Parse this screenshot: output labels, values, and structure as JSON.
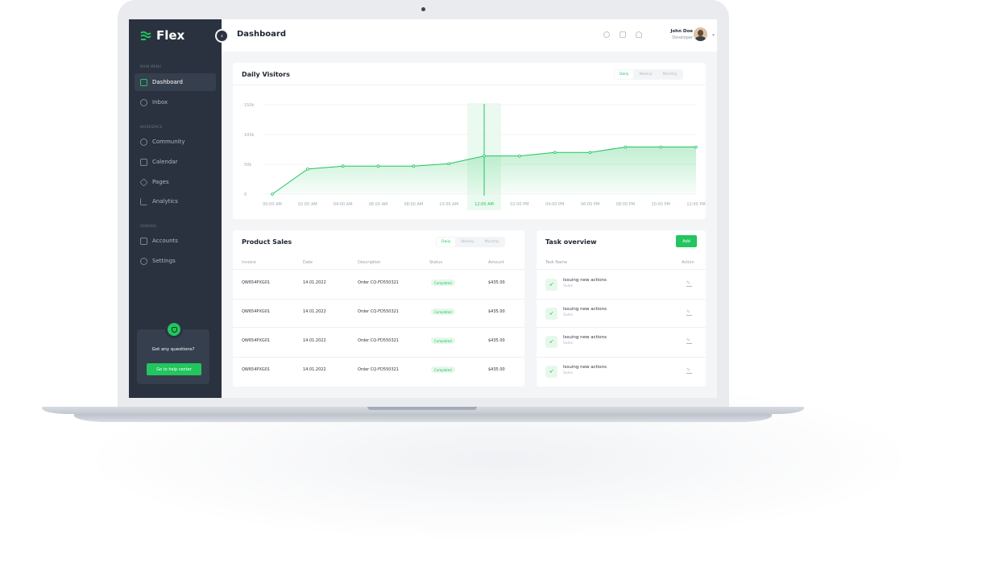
{
  "app": {
    "name": "Flex"
  },
  "sidebar": {
    "sections": [
      {
        "label": "MAIN MENU",
        "items": [
          {
            "label": "Dashboard",
            "icon": "chart-icon",
            "active": true
          },
          {
            "label": "Inbox",
            "icon": "inbox-icon"
          }
        ]
      },
      {
        "label": "Workspace",
        "items": [
          {
            "label": "Community",
            "icon": "people-icon"
          },
          {
            "label": "Calendar",
            "icon": "calendar-icon"
          },
          {
            "label": "Pages",
            "icon": "layers-icon"
          },
          {
            "label": "Analytics",
            "icon": "bars-icon"
          }
        ]
      },
      {
        "label": "General",
        "items": [
          {
            "label": "Accounts",
            "icon": "user-icon"
          },
          {
            "label": "Settings",
            "icon": "gear-icon"
          }
        ]
      }
    ],
    "help": {
      "text": "Got any questions?",
      "button": "Go to help center"
    }
  },
  "header": {
    "title": "Dashboard",
    "user_name": "John Doe",
    "user_role": "Developer"
  },
  "visitors": {
    "title": "Daily Visitors",
    "tabs": [
      "Daily",
      "Weekly",
      "Monthly"
    ],
    "active_tab": "Daily"
  },
  "chart_data": {
    "type": "area",
    "title": "Daily Visitors",
    "x": [
      "00:00 AM",
      "02:00 AM",
      "04:00 AM",
      "06:00 AM",
      "08:00 AM",
      "10:00 AM",
      "12:00 AM",
      "02:00 PM",
      "04:00 PM",
      "06:00 PM",
      "08:00 PM",
      "10:00 PM",
      "12:00 PM"
    ],
    "y_ticks": [
      "0",
      "50k",
      "100k",
      "150k"
    ],
    "ylim": [
      0,
      150000
    ],
    "values": [
      0,
      42000,
      47000,
      47000,
      47000,
      51000,
      64000,
      64000,
      70000,
      70000,
      79000,
      79000,
      79000
    ],
    "highlight_index": 6,
    "color": "#22c55e",
    "grid": true
  },
  "sales": {
    "title": "Product Sales",
    "tabs": [
      "Daily",
      "Weekly",
      "Monthly"
    ],
    "active_tab": "Daily",
    "columns": [
      "Invoice",
      "Date",
      "Description",
      "Status",
      "Amount"
    ],
    "rows": [
      {
        "invoice": "QW654PXG01",
        "date": "14.01.2022",
        "description": "Order CQ-FD550321",
        "status": "Completed",
        "amount": "$435.00"
      },
      {
        "invoice": "QW654PXG01",
        "date": "14.01.2022",
        "description": "Order CQ-FD550321",
        "status": "Completed",
        "amount": "$435.00"
      },
      {
        "invoice": "QW654PXG01",
        "date": "14.01.2022",
        "description": "Order CQ-FD550321",
        "status": "Completed",
        "amount": "$435.00"
      },
      {
        "invoice": "QW654PXG01",
        "date": "14.01.2022",
        "description": "Order CQ-FD550321",
        "status": "Completed",
        "amount": "$435.00"
      }
    ]
  },
  "tasks": {
    "title": "Task overview",
    "add_label": "Add",
    "columns": [
      "Task Name",
      "Action"
    ],
    "items": [
      {
        "name": "Issuing new actions",
        "team": "Sales"
      },
      {
        "name": "Issuing new actions",
        "team": "Sales"
      },
      {
        "name": "Issuing new actions",
        "team": "Sales"
      },
      {
        "name": "Issuing new actions",
        "team": "Sales"
      }
    ]
  },
  "colors": {
    "accent": "#22c55e",
    "sidebar": "#2a3240",
    "background": "#f4f5f7"
  }
}
